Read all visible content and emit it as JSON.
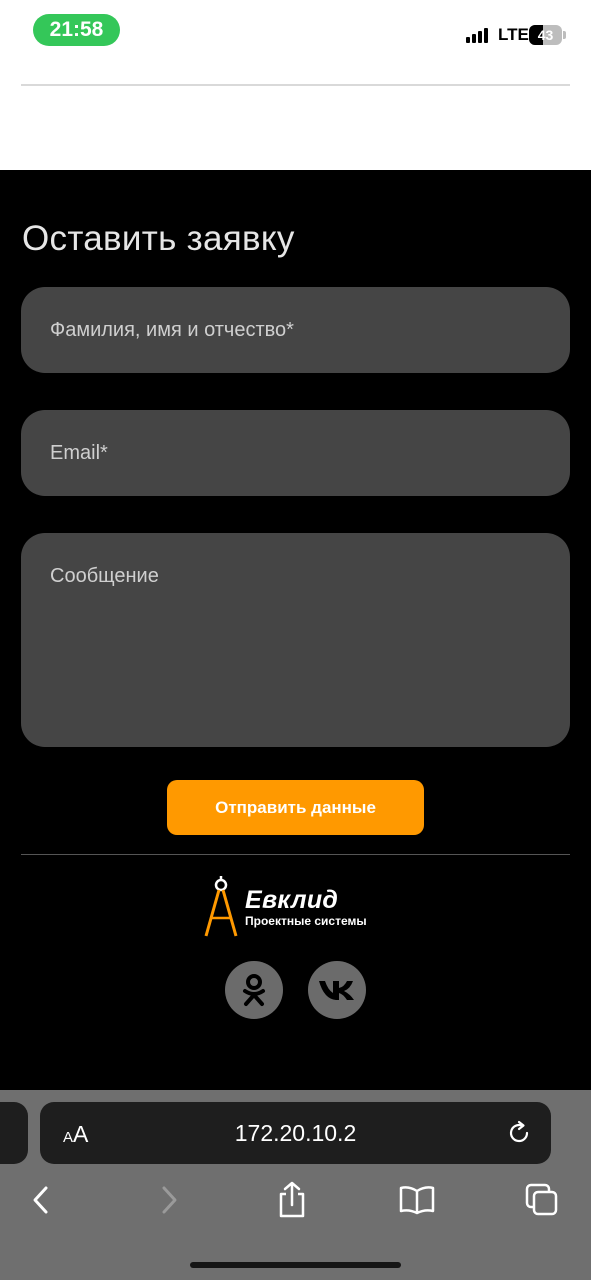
{
  "status_bar": {
    "time": "21:58",
    "network": "LTE",
    "battery": "43",
    "battery_level": 0.43
  },
  "form": {
    "title": "Оставить заявку",
    "name_placeholder": "Фамилия, имя и отчество*",
    "email_placeholder": "Email*",
    "message_placeholder": "Сообщение",
    "submit_label": "Отправить данные",
    "accent_color": "#ff9900"
  },
  "footer": {
    "logo_name": "Евклид",
    "logo_subtitle": "Проектные системы",
    "logo_icon": "compass-icon",
    "socials": [
      {
        "name": "odnoklassniki",
        "icon": "odnoklassniki-icon"
      },
      {
        "name": "vk",
        "icon": "vk-icon"
      }
    ]
  },
  "browser": {
    "text_size_label_small": "A",
    "text_size_label_large": "A",
    "url": "172.20.10.2",
    "icons": [
      "reload-icon",
      "back-icon",
      "forward-icon",
      "share-icon",
      "bookmarks-icon",
      "tabs-icon"
    ]
  }
}
